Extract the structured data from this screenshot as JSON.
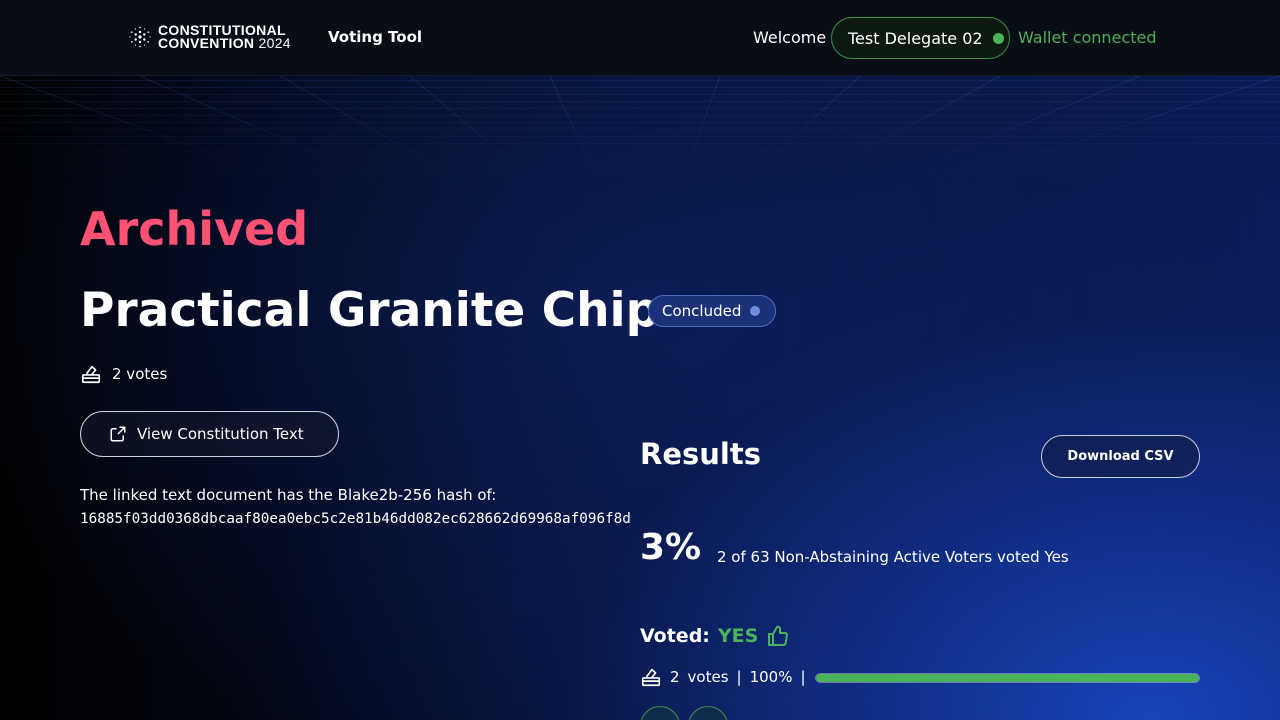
{
  "header": {
    "logo_line1": "CONSTITUTIONAL",
    "logo_line2": "CONVENTION",
    "logo_year": "2024",
    "nav_link": "Voting Tool",
    "welcome": "Welcome",
    "user_name": "Test Delegate 02",
    "wallet_status": "Wallet connected"
  },
  "proposal": {
    "state": "Archived",
    "title": "Practical Granite Chips",
    "status_badge": "Concluded",
    "votes": "2 votes",
    "view_button": "View Constitution Text",
    "hash_label": "The linked text document has the Blake2b-256 hash of:",
    "hash_value": "16885f03dd0368dbcaaf80ea0ebc5c2e81b46dd082ec628662d69968af096f8d"
  },
  "results": {
    "title": "Results",
    "download_button": "Download CSV",
    "percent": "3%",
    "description": "2 of 63 Non-Abstaining Active Voters voted Yes",
    "voted_label": "Voted:",
    "voted_value": "YES",
    "vote_count": "2",
    "votes_word": "votes",
    "vote_percent": "100%",
    "progress_fraction": 1.0
  },
  "colors": {
    "accent_green": "#4bb35a",
    "archived_pink": "#ff5274",
    "badge_blue": "#1b3278"
  },
  "icons": {
    "logo": "cardano-logo-icon",
    "ballot": "ballot-box-icon",
    "external": "external-link-icon",
    "thumb": "thumbs-up-icon",
    "status_dot": "status-dot-icon"
  }
}
